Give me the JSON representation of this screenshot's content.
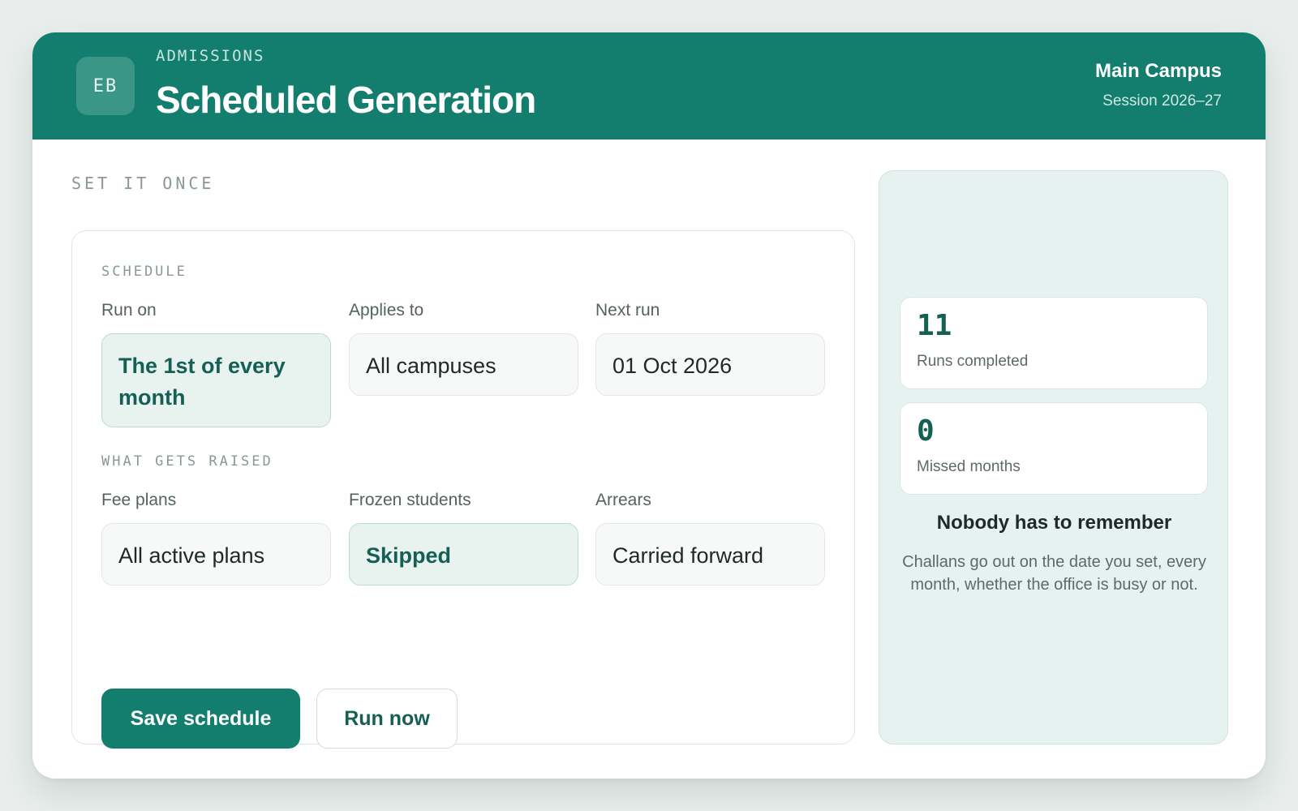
{
  "header": {
    "avatar_initials": "EB",
    "eyebrow": "ADMISSIONS",
    "title": "Scheduled Generation",
    "campus": "Main Campus",
    "session": "Session 2026–27",
    "color": "#137e6e"
  },
  "main": {
    "section_eyebrow": "SET IT ONCE",
    "schedule": {
      "label": "SCHEDULE",
      "run_on": {
        "label": "Run on",
        "value": "The 1st of every month"
      },
      "applies_to": {
        "label": "Applies to",
        "value": "All campuses"
      },
      "next_run": {
        "label": "Next run",
        "value": "01 Oct 2026"
      }
    },
    "raised": {
      "label": "WHAT GETS RAISED",
      "fee_plans": {
        "label": "Fee plans",
        "value": "All active plans"
      },
      "frozen_students": {
        "label": "Frozen students",
        "value": "Skipped"
      },
      "arrears": {
        "label": "Arrears",
        "value": "Carried forward"
      }
    },
    "actions": {
      "save_label": "Save schedule",
      "run_label": "Run now"
    }
  },
  "side": {
    "stats": [
      {
        "value": "11",
        "caption": "Runs completed"
      },
      {
        "value": "0",
        "caption": "Missed months"
      }
    ],
    "title": "Nobody has to remember",
    "text": "Challans go out on the date you set, every month, whether the office is busy or not."
  }
}
